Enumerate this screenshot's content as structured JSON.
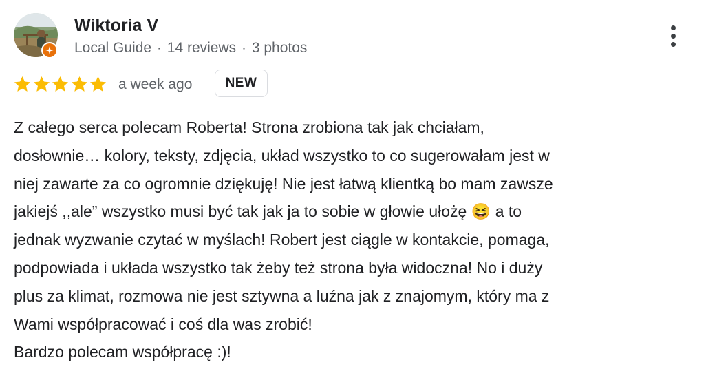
{
  "reviewer": {
    "name": "Wiktoria V",
    "role": "Local Guide",
    "separator": "·",
    "reviews_count": "14 reviews",
    "photos_count": "3 photos",
    "avatar": "profile-photo",
    "badge_icon": "local-guide-star-icon"
  },
  "rating": {
    "stars": 5,
    "max": 5,
    "star_color": "#fbbc04"
  },
  "time_ago": "a week ago",
  "badge_label": "NEW",
  "menu_icon": "more-vertical-icon",
  "review_text_lines": [
    "Z całego serca polecam Roberta! Strona zrobiona tak jak chciałam,",
    "dosłownie… kolory, teksty, zdjęcia, układ wszystko to co sugerowałam jest w",
    "niej zawarte za co ogromnie dziękuję! Nie jest łatwą klientką bo mam zawsze",
    "jakiejś ,,ale” wszystko musi być tak jak ja to sobie w głowie ułożę 😆 a to",
    "jednak wyzwanie czytać w myślach! Robert jest ciągle w kontakcie, pomaga,",
    "podpowiada i układa wszystko tak żeby też strona była widoczna! No i duży",
    "plus za klimat, rozmowa nie jest sztywna a luźna jak z znajomym, który ma z",
    "Wami współpracować i coś dla was zrobić!",
    "Bardzo polecam współpracę :)!"
  ],
  "colors": {
    "text_primary": "#202124",
    "text_secondary": "#5f6368",
    "badge_border": "#dadce0",
    "guide_badge": "#e8710a"
  }
}
